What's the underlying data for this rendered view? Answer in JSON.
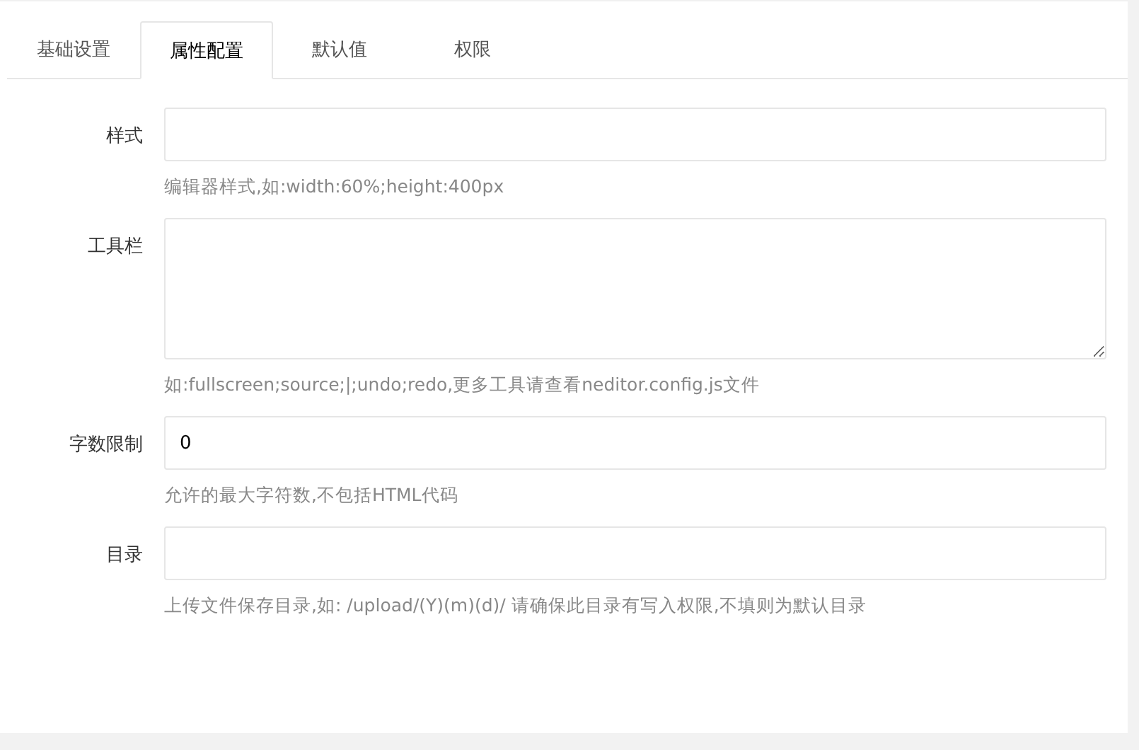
{
  "tabs": [
    {
      "label": "基础设置",
      "selected": false
    },
    {
      "label": "属性配置",
      "selected": true
    },
    {
      "label": "默认值",
      "selected": false
    },
    {
      "label": "权限",
      "selected": false
    }
  ],
  "fields": [
    {
      "kind": "input",
      "label": "样式",
      "hint": "编辑器样式,如:width:60%;height:400px"
    },
    {
      "kind": "textarea",
      "label": "工具栏",
      "hint": "如:fullscreen;source;|;undo;redo,更多工具请查看neditor.config.js文件"
    },
    {
      "kind": "input",
      "label": "字数限制",
      "value": "0",
      "hint": "允许的最大字符数,不包括HTML代码"
    },
    {
      "kind": "input",
      "label": "目录",
      "hint": "上传文件保存目录,如: /upload/(Y)(m)(d)/ 请确保此目录有写入权限,不填则为默认目录"
    }
  ]
}
